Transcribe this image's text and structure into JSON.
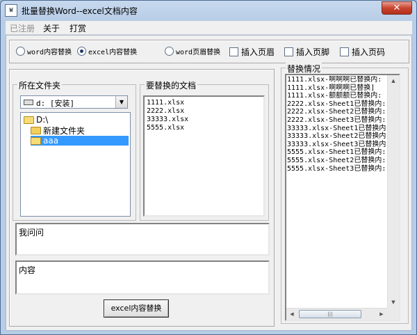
{
  "window": {
    "title": "批量替换Word--excel文档内容",
    "app_icon": "W",
    "close_glyph": "✕"
  },
  "menu": [
    {
      "label": "已注册",
      "disabled": true
    },
    {
      "label": "关于",
      "disabled": false
    },
    {
      "label": "打赏",
      "disabled": false
    }
  ],
  "options": {
    "word_content": "word内容替换",
    "excel_content": "excel内容替换",
    "word_header_footer": "word页眉替换",
    "insert_header": "插入页眉",
    "insert_footer": "插入页脚",
    "insert_page_number": "插入页码",
    "selected": "excel_content"
  },
  "folder_panel": {
    "label": "所在文件夹",
    "drive": "d: [安装]",
    "tree": [
      {
        "label": "D:\\",
        "depth": 0,
        "open": true,
        "selected": false
      },
      {
        "label": "新建文件夹",
        "depth": 1,
        "open": false,
        "selected": false
      },
      {
        "label": "aaa",
        "depth": 1,
        "open": true,
        "selected": true
      }
    ]
  },
  "files_panel": {
    "label": "要替换的文档",
    "files": [
      "1111.xlsx",
      "2222.xlsx",
      "33333.xlsx",
      "5555.xlsx"
    ]
  },
  "find_text": {
    "value": "我问问"
  },
  "replace_text": {
    "value": "内容"
  },
  "action_button": "excel内容替换",
  "log_panel": {
    "label": "替换情况",
    "lines": [
      "1111.xlsx-啊啊啊已替换内:",
      "1111.xlsx-啊啊啊已替换]",
      "1111.xlsx-额额额已替换内:",
      "2222.xlsx-Sheet1已替换内:",
      "2222.xlsx-Sheet2已替换内:",
      "2222.xlsx-Sheet3已替换内:",
      "33333.xlsx-Sheet1已替换内",
      "33333.xlsx-Sheet2已替换内",
      "33333.xlsx-Sheet3已替换内",
      "5555.xlsx-Sheet1已替换内:",
      "5555.xlsx-Sheet2已替换内:",
      "5555.xlsx-Sheet3已替换内:"
    ]
  }
}
